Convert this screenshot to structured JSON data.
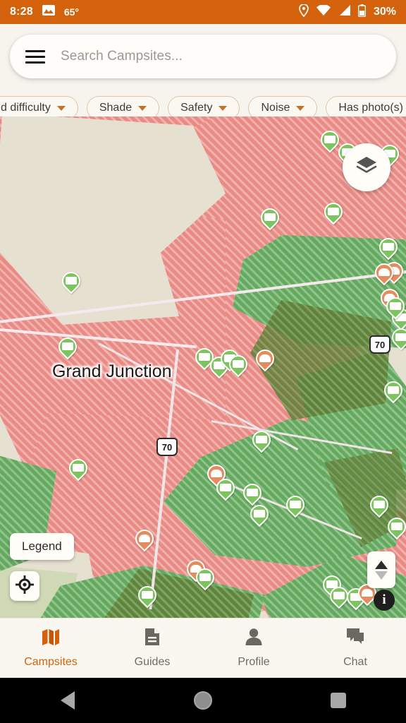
{
  "status_bar": {
    "time": "8:28",
    "temperature": "65°",
    "battery_percent": "30%",
    "icons": [
      "image-icon",
      "location-pin-icon",
      "wifi-icon",
      "cellular-signal-icon",
      "battery-icon"
    ]
  },
  "search": {
    "placeholder": "Search Campsites...",
    "value": "",
    "menu_icon": "hamburger-menu-icon"
  },
  "filters": [
    {
      "label": "d difficulty",
      "has_dropdown": true
    },
    {
      "label": "Shade",
      "has_dropdown": true
    },
    {
      "label": "Safety",
      "has_dropdown": true
    },
    {
      "label": "Noise",
      "has_dropdown": true
    },
    {
      "label": "Has photo(s)",
      "has_dropdown": false
    }
  ],
  "map": {
    "city_label": "Grand Junction",
    "highway_shields": [
      "70",
      "70"
    ],
    "legend_button": "Legend",
    "layers_icon": "layers-icon",
    "locate_icon": "locate-crosshair-icon",
    "tilt_icon": "tilt-compass-icon",
    "info_icon": "info-icon",
    "colors": {
      "restricted_land": "#E98A84",
      "public_land": "#63A95E",
      "forest_land": "#5C7D33",
      "base_terrain": "#E8E2D4",
      "pin_available": "#7CC45E",
      "pin_alternate": "#E58B5E"
    }
  },
  "bottom_nav": {
    "active": "Campsites",
    "items": [
      {
        "label": "Campsites",
        "icon": "map-icon"
      },
      {
        "label": "Guides",
        "icon": "document-icon"
      },
      {
        "label": "Profile",
        "icon": "person-icon"
      },
      {
        "label": "Chat",
        "icon": "chat-bubble-icon"
      }
    ]
  },
  "system_nav": {
    "back": "back-button",
    "home": "home-button",
    "recents": "recents-button"
  },
  "theme": {
    "accent": "#D4620C",
    "chrome_bg": "#F7F4EE"
  }
}
